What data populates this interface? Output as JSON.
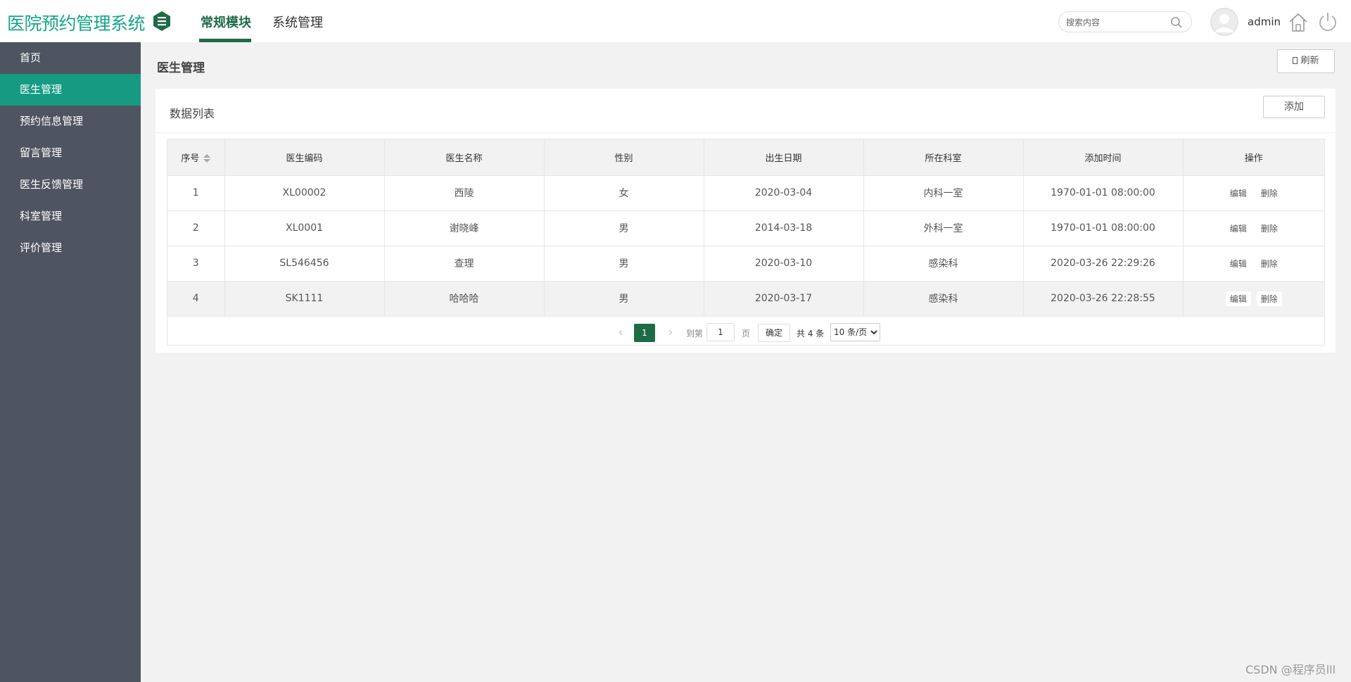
{
  "app": {
    "title": "医院预约管理系统"
  },
  "header": {
    "tabs": [
      {
        "label": "常规模块",
        "active": true
      },
      {
        "label": "系统管理",
        "active": false
      }
    ],
    "search": {
      "placeholder": "搜索内容",
      "value": ""
    },
    "username": "admin",
    "accent_color": "#1e6b48",
    "logo_color": "#17a589"
  },
  "sidebar": {
    "background": "#4f5461",
    "active_color": "#169b82",
    "items": [
      {
        "label": "首页",
        "active": false
      },
      {
        "label": "医生管理",
        "active": true
      },
      {
        "label": "预约信息管理",
        "active": false
      },
      {
        "label": "留言管理",
        "active": false
      },
      {
        "label": "医生反馈管理",
        "active": false
      },
      {
        "label": "科室管理",
        "active": false
      },
      {
        "label": "评价管理",
        "active": false
      }
    ]
  },
  "page": {
    "title": "医生管理",
    "refresh_label": "刷新"
  },
  "panel": {
    "title": "数据列表",
    "add_label": "添加"
  },
  "table": {
    "columns": [
      "序号",
      "医生编码",
      "医生名称",
      "性别",
      "出生日期",
      "所在科室",
      "添加时间",
      "操作"
    ],
    "rows": [
      {
        "no": "1",
        "code": "XL00002",
        "name": "西陵",
        "gender": "女",
        "birth": "2020-03-04",
        "dept": "内科一室",
        "added": "1970-01-01 08:00:00"
      },
      {
        "no": "2",
        "code": "XL0001",
        "name": "谢晓峰",
        "gender": "男",
        "birth": "2014-03-18",
        "dept": "外科一室",
        "added": "1970-01-01 08:00:00"
      },
      {
        "no": "3",
        "code": "SL546456",
        "name": "查理",
        "gender": "男",
        "birth": "2020-03-10",
        "dept": "感染科",
        "added": "2020-03-26 22:29:26"
      },
      {
        "no": "4",
        "code": "SK1111",
        "name": "哈哈哈",
        "gender": "男",
        "birth": "2020-03-17",
        "dept": "感染科",
        "added": "2020-03-26 22:28:55"
      }
    ],
    "edit_label": "编辑",
    "delete_label": "删除"
  },
  "pager": {
    "current": "1",
    "goto_label": "到第",
    "goto_value": "1",
    "page_unit": "页",
    "confirm_label": "确定",
    "total_text": "共 4 条",
    "page_size": "10 条/页"
  },
  "watermark": "CSDN @程序员lll"
}
